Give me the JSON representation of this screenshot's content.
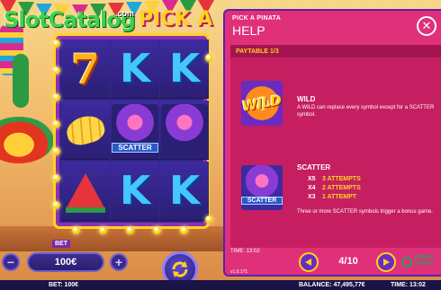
{
  "logo": {
    "text": "SlotCatalog",
    "suffix": ".com",
    "game_title": "PICK A"
  },
  "reels": {
    "columns": [
      [
        "seven",
        "banana",
        "watermelon"
      ],
      [
        "k",
        "scatter",
        "k"
      ],
      [
        "k",
        "pinata",
        "k"
      ]
    ],
    "scatter_label": "SCATTER"
  },
  "bet": {
    "label": "BET",
    "value": "100€",
    "minus": "−",
    "plus": "+"
  },
  "status": {
    "bet": "BET: 100€",
    "balance": "BALANCE: 47,495,77€",
    "time": "TIME: 13:02"
  },
  "help": {
    "subtitle": "PICK A PINATA",
    "title": "HELP",
    "close": "✕",
    "paytable_header": "PAYTABLE 1/3",
    "wild": {
      "icon_label": "WILD",
      "title": "WILD",
      "text": "A WILD can replace every symbol except for a SCATTER symbol."
    },
    "scatter": {
      "icon_label": "SCATTER",
      "title": "SCATTER",
      "pays": [
        {
          "mult": "X5",
          "attempts": "3 ATTEMPTS"
        },
        {
          "mult": "X4",
          "attempts": "2 ATTEMPTS"
        },
        {
          "mult": "X3",
          "attempts": "1 ATTEMPT"
        }
      ],
      "text": "Three or more SCATTER symbols trigger a bonus game."
    },
    "footer": {
      "time": "TIME: 13:02",
      "version": "v1.0.171",
      "page": "4/10"
    },
    "brand": {
      "line1": "GREEN",
      "line2": "GAMES"
    }
  },
  "colors": {
    "panel": "#e0307a",
    "accent": "#ffd21e",
    "reel_bg": "#2f2a83",
    "frame": "#8d2fb7"
  }
}
